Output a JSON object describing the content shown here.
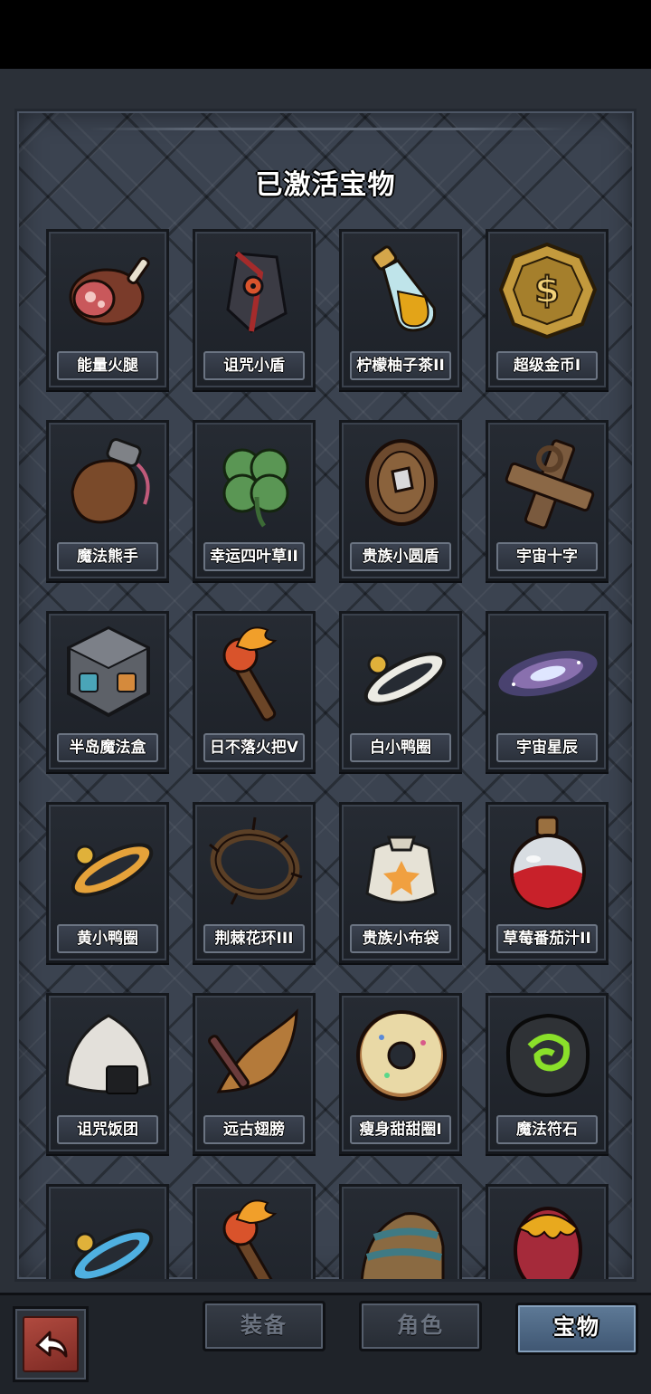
{
  "header": {
    "title": "已激活宝物"
  },
  "treasures": [
    {
      "name": "能量火腿",
      "icon": "ham-icon"
    },
    {
      "name": "诅咒小盾",
      "icon": "cursed-shield-icon"
    },
    {
      "name": "柠檬柚子茶II",
      "icon": "potion-bottle-icon"
    },
    {
      "name": "超级金币I",
      "icon": "gold-coin-icon"
    },
    {
      "name": "魔法熊手",
      "icon": "bear-paw-icon"
    },
    {
      "name": "幸运四叶草II",
      "icon": "four-leaf-clover-icon"
    },
    {
      "name": "贵族小圆盾",
      "icon": "round-shield-icon"
    },
    {
      "name": "宇宙十字",
      "icon": "wooden-cross-icon"
    },
    {
      "name": "半岛魔法盒",
      "icon": "magic-cube-icon"
    },
    {
      "name": "日不落火把V",
      "icon": "torch-icon"
    },
    {
      "name": "白小鸭圈",
      "icon": "white-duck-ring-icon"
    },
    {
      "name": "宇宙星辰",
      "icon": "galaxy-icon"
    },
    {
      "name": "黄小鸭圈",
      "icon": "yellow-duck-ring-icon"
    },
    {
      "name": "荆棘花环III",
      "icon": "thorn-wreath-icon"
    },
    {
      "name": "贵族小布袋",
      "icon": "cloth-bag-icon"
    },
    {
      "name": "草莓番茄汁II",
      "icon": "red-potion-icon"
    },
    {
      "name": "诅咒饭团",
      "icon": "rice-ball-icon"
    },
    {
      "name": "远古翅膀",
      "icon": "ancient-wing-icon"
    },
    {
      "name": "瘦身甜甜圈I",
      "icon": "donut-icon"
    },
    {
      "name": "魔法符石",
      "icon": "rune-stone-icon"
    },
    {
      "name": "",
      "icon": "blue-duck-ring-icon"
    },
    {
      "name": "",
      "icon": "torch-icon"
    },
    {
      "name": "",
      "icon": "striped-hat-icon"
    },
    {
      "name": "",
      "icon": "dragon-egg-icon"
    }
  ],
  "tabs": [
    {
      "label": "装备",
      "active": false
    },
    {
      "label": "角色",
      "active": false
    },
    {
      "label": "宝物",
      "active": true
    }
  ],
  "back_button": {
    "icon": "back-arrow-icon"
  }
}
